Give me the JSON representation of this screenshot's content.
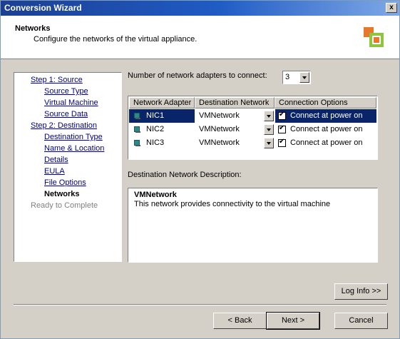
{
  "window": {
    "title": "Conversion Wizard",
    "close_glyph": "x"
  },
  "header": {
    "title": "Networks",
    "subtitle": "Configure the networks of the virtual appliance.",
    "logo_icon": "vmware-converter-logo-icon"
  },
  "nav": {
    "items": [
      {
        "label": "Step 1: Source",
        "state": "link"
      },
      {
        "label": "Source Type",
        "state": "link"
      },
      {
        "label": "Virtual Machine",
        "state": "link"
      },
      {
        "label": "Source Data",
        "state": "link"
      },
      {
        "label": "Step 2: Destination",
        "state": "link"
      },
      {
        "label": "Destination Type",
        "state": "link"
      },
      {
        "label": "Name & Location",
        "state": "link"
      },
      {
        "label": "Details",
        "state": "link"
      },
      {
        "label": "EULA",
        "state": "link"
      },
      {
        "label": "File Options",
        "state": "link"
      },
      {
        "label": "Networks",
        "state": "current"
      },
      {
        "label": "Ready to Complete",
        "state": "disabled"
      }
    ]
  },
  "adapters": {
    "label": "Number of network adapters to connect:",
    "value": "3"
  },
  "grid": {
    "columns": [
      "Network Adapter",
      "Destination Network",
      "Connection Options"
    ],
    "rows": [
      {
        "adapter": "NIC1",
        "network": "VMNetwork",
        "option": "Connect at power on",
        "checked": true,
        "selected": true
      },
      {
        "adapter": "NIC2",
        "network": "VMNetwork",
        "option": "Connect at power on",
        "checked": true,
        "selected": false
      },
      {
        "adapter": "NIC3",
        "network": "VMNetwork",
        "option": "Connect at power on",
        "checked": true,
        "selected": false
      }
    ]
  },
  "description": {
    "label": "Destination Network Description:",
    "title": "VMNetwork",
    "body": "This network provides connectivity to the virtual machine"
  },
  "buttons": {
    "log_info": "Log Info >>",
    "back": "< Back",
    "next": "Next >",
    "cancel": "Cancel"
  },
  "colors": {
    "selection": "#0a246a",
    "link": "#00008b",
    "face": "#d4d0c8"
  }
}
